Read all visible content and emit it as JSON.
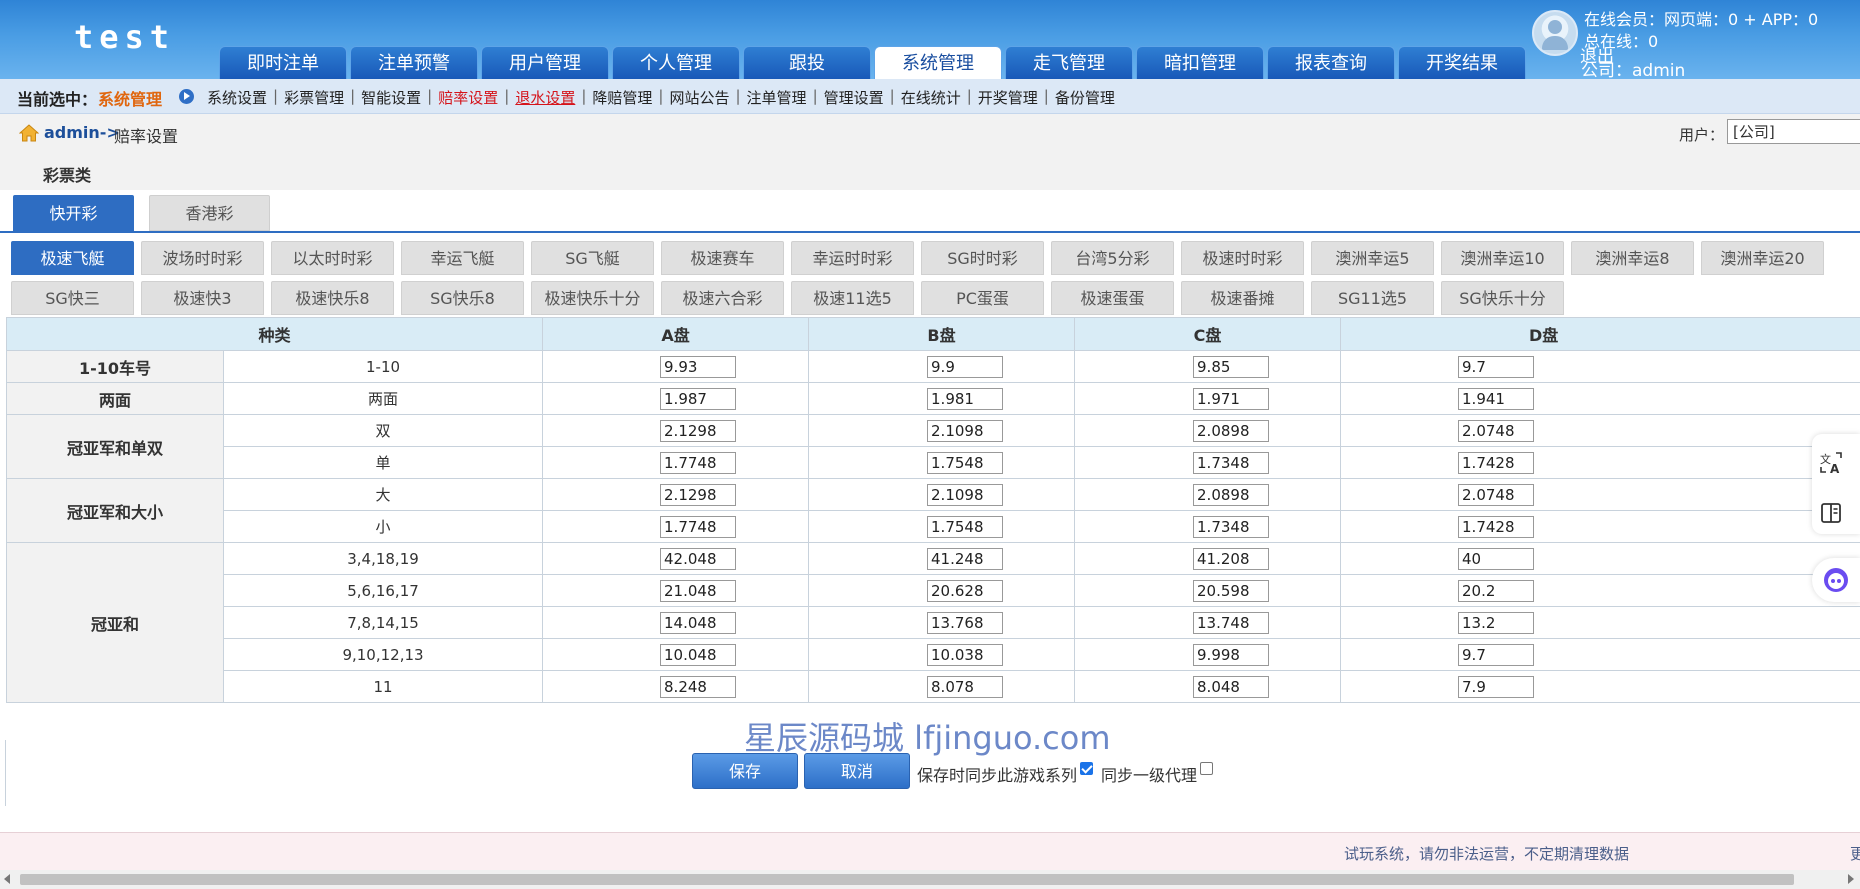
{
  "header": {
    "logo": "test",
    "nav_tabs": [
      "即时注单",
      "注单预警",
      "用户管理",
      "个人管理",
      "跟投",
      "系统管理",
      "走飞管理",
      "暗扣管理",
      "报表查询",
      "开奖结果"
    ],
    "active_nav_index": 5,
    "online_line1": "在线会员：网页端：0 + APP：0",
    "online_line2": "总在线：0",
    "logout_label": "退出",
    "company_line": "公司：admin"
  },
  "subnav": {
    "current_label": "当前选中：",
    "current_value": "系统管理",
    "links": [
      {
        "label": "系统设置",
        "style": "normal"
      },
      {
        "label": "彩票管理",
        "style": "normal"
      },
      {
        "label": "智能设置",
        "style": "normal"
      },
      {
        "label": "赔率设置",
        "style": "red"
      },
      {
        "label": "退水设置",
        "style": "red-ul"
      },
      {
        "label": "降赔管理",
        "style": "normal"
      },
      {
        "label": "网站公告",
        "style": "normal"
      },
      {
        "label": "注单管理",
        "style": "normal"
      },
      {
        "label": "管理设置",
        "style": "normal"
      },
      {
        "label": "在线统计",
        "style": "normal"
      },
      {
        "label": "开奖管理",
        "style": "normal"
      },
      {
        "label": "备份管理",
        "style": "normal"
      }
    ]
  },
  "breadcrumb": {
    "admin": "admin->",
    "page": "赔率设置",
    "user_label": "用户：",
    "user_value": "[公司]"
  },
  "section_title": "彩票类",
  "category_tabs": [
    "快开彩",
    "香港彩"
  ],
  "active_category_index": 0,
  "game_tabs_row1": [
    "极速飞艇",
    "波场时时彩",
    "以太时时彩",
    "幸运飞艇",
    "SG飞艇",
    "极速赛车",
    "幸运时时彩",
    "SG时时彩",
    "台湾5分彩",
    "极速时时彩",
    "澳洲幸运5",
    "澳洲幸运10",
    "澳洲幸运8",
    "澳洲幸运20"
  ],
  "game_tabs_row2": [
    "SG快三",
    "极速快3",
    "极速快乐8",
    "SG快乐8",
    "极速快乐十分",
    "极速六合彩",
    "极速11选5",
    "PC蛋蛋",
    "极速蛋蛋",
    "极速番摊",
    "SG11选5",
    "SG快乐十分"
  ],
  "active_game_index": 0,
  "table": {
    "headers": [
      "种类",
      "A盘",
      "B盘",
      "C盘",
      "D盘"
    ],
    "groups": [
      {
        "name": "1-10车号",
        "rows": [
          {
            "item": "1-10",
            "a": "9.93",
            "b": "9.9",
            "c": "9.85",
            "d": "9.7"
          }
        ]
      },
      {
        "name": "两面",
        "rows": [
          {
            "item": "两面",
            "a": "1.987",
            "b": "1.981",
            "c": "1.971",
            "d": "1.941"
          }
        ]
      },
      {
        "name": "冠亚军和单双",
        "rows": [
          {
            "item": "双",
            "a": "2.1298",
            "b": "2.1098",
            "c": "2.0898",
            "d": "2.0748"
          },
          {
            "item": "单",
            "a": "1.7748",
            "b": "1.7548",
            "c": "1.7348",
            "d": "1.7428"
          }
        ]
      },
      {
        "name": "冠亚军和大小",
        "rows": [
          {
            "item": "大",
            "a": "2.1298",
            "b": "2.1098",
            "c": "2.0898",
            "d": "2.0748"
          },
          {
            "item": "小",
            "a": "1.7748",
            "b": "1.7548",
            "c": "1.7348",
            "d": "1.7428"
          }
        ]
      },
      {
        "name": "冠亚和",
        "rows": [
          {
            "item": "3,4,18,19",
            "a": "42.048",
            "b": "41.248",
            "c": "41.208",
            "d": "40"
          },
          {
            "item": "5,6,16,17",
            "a": "21.048",
            "b": "20.628",
            "c": "20.598",
            "d": "20.2"
          },
          {
            "item": "7,8,14,15",
            "a": "14.048",
            "b": "13.768",
            "c": "13.748",
            "d": "13.2"
          },
          {
            "item": "9,10,12,13",
            "a": "10.048",
            "b": "10.038",
            "c": "9.998",
            "d": "9.7"
          },
          {
            "item": "11",
            "a": "8.248",
            "b": "8.078",
            "c": "8.048",
            "d": "7.9"
          }
        ]
      }
    ]
  },
  "watermark": "星辰源码城  lfjinguo.com",
  "actions": {
    "save_label": "保存",
    "cancel_label": "取消",
    "sync_series_label": "保存时同步此游戏系列",
    "sync_series_checked": true,
    "sync_agent_label": "同步一级代理",
    "sync_agent_checked": false
  },
  "footer": {
    "notice": "试玩系统，请勿非法运营，不定期清理数据",
    "more": "更"
  },
  "icons": [
    "home-icon",
    "play-circle-icon",
    "user-avatar-icon",
    "translate-icon",
    "reader-icon",
    "assistant-icon"
  ],
  "colors": {
    "primary": "#2e6dc2",
    "header": "#3a8ddb",
    "accent_orange": "#e0660e",
    "link_red": "#d5141b",
    "table_header": "#d9ecf6"
  }
}
